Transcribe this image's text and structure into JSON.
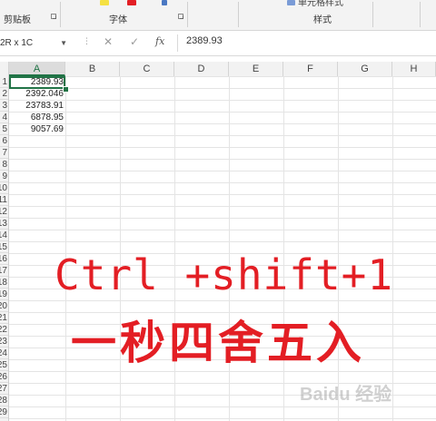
{
  "ribbon": {
    "clipboard_label": "剪贴板",
    "font_label": "字体",
    "cell_style_label": "单元格样式",
    "styles_label": "样式"
  },
  "formula_bar": {
    "name_box": "2R x 1C",
    "cancel_icon": "✕",
    "enter_icon": "✓",
    "fx_label": "fx",
    "value": "2389.93"
  },
  "columns": [
    "A",
    "B",
    "C",
    "D",
    "E",
    "F",
    "G",
    "H"
  ],
  "rows": [
    "1",
    "2",
    "3",
    "4",
    "5",
    "6",
    "7",
    "8",
    "9",
    "10",
    "11",
    "12",
    "13",
    "14",
    "15",
    "16",
    "17",
    "18",
    "19",
    "20",
    "21",
    "22",
    "23",
    "24",
    "25",
    "26",
    "27",
    "28",
    "29"
  ],
  "cells": {
    "A1": "2389.93",
    "A2": "2392.046",
    "A3": "23783.91",
    "A4": "6878.95",
    "A5": "9057.69"
  },
  "overlay": {
    "line1": "Ctrl +shift+1",
    "line2": "一秒四舍五入"
  },
  "watermark": "Baidu 经验",
  "colors": {
    "accent": "#217346",
    "overlay": "#e31e24"
  }
}
